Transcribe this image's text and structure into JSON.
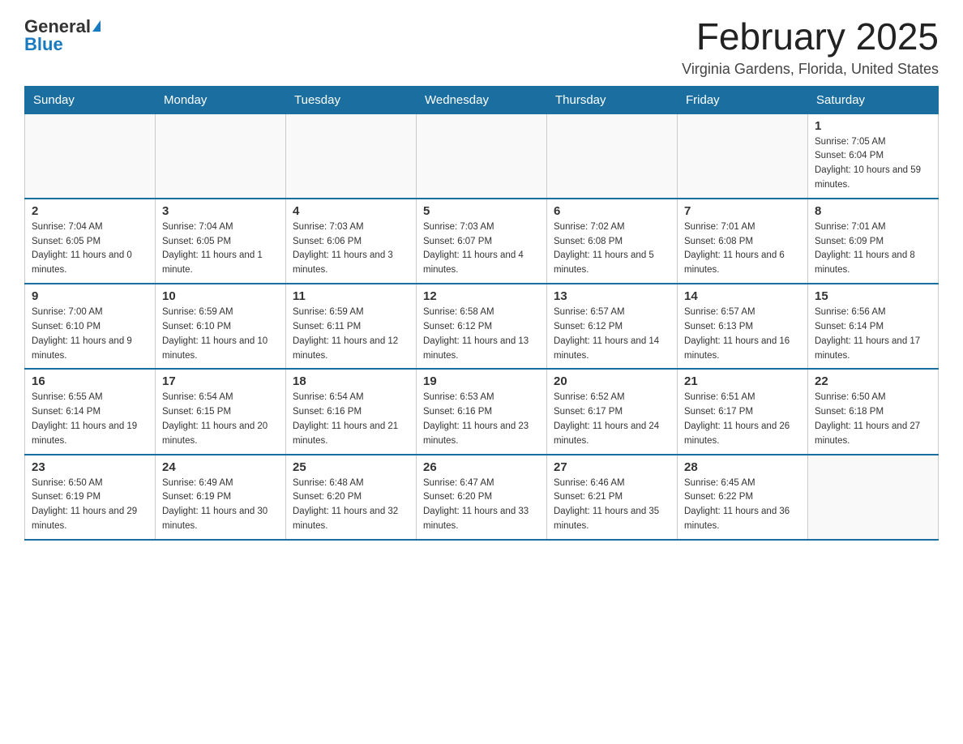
{
  "logo": {
    "general": "General",
    "blue": "Blue"
  },
  "title": "February 2025",
  "subtitle": "Virginia Gardens, Florida, United States",
  "days_of_week": [
    "Sunday",
    "Monday",
    "Tuesday",
    "Wednesday",
    "Thursday",
    "Friday",
    "Saturday"
  ],
  "weeks": [
    [
      {
        "day": "",
        "sunrise": "",
        "sunset": "",
        "daylight": ""
      },
      {
        "day": "",
        "sunrise": "",
        "sunset": "",
        "daylight": ""
      },
      {
        "day": "",
        "sunrise": "",
        "sunset": "",
        "daylight": ""
      },
      {
        "day": "",
        "sunrise": "",
        "sunset": "",
        "daylight": ""
      },
      {
        "day": "",
        "sunrise": "",
        "sunset": "",
        "daylight": ""
      },
      {
        "day": "",
        "sunrise": "",
        "sunset": "",
        "daylight": ""
      },
      {
        "day": "1",
        "sunrise": "Sunrise: 7:05 AM",
        "sunset": "Sunset: 6:04 PM",
        "daylight": "Daylight: 10 hours and 59 minutes."
      }
    ],
    [
      {
        "day": "2",
        "sunrise": "Sunrise: 7:04 AM",
        "sunset": "Sunset: 6:05 PM",
        "daylight": "Daylight: 11 hours and 0 minutes."
      },
      {
        "day": "3",
        "sunrise": "Sunrise: 7:04 AM",
        "sunset": "Sunset: 6:05 PM",
        "daylight": "Daylight: 11 hours and 1 minute."
      },
      {
        "day": "4",
        "sunrise": "Sunrise: 7:03 AM",
        "sunset": "Sunset: 6:06 PM",
        "daylight": "Daylight: 11 hours and 3 minutes."
      },
      {
        "day": "5",
        "sunrise": "Sunrise: 7:03 AM",
        "sunset": "Sunset: 6:07 PM",
        "daylight": "Daylight: 11 hours and 4 minutes."
      },
      {
        "day": "6",
        "sunrise": "Sunrise: 7:02 AM",
        "sunset": "Sunset: 6:08 PM",
        "daylight": "Daylight: 11 hours and 5 minutes."
      },
      {
        "day": "7",
        "sunrise": "Sunrise: 7:01 AM",
        "sunset": "Sunset: 6:08 PM",
        "daylight": "Daylight: 11 hours and 6 minutes."
      },
      {
        "day": "8",
        "sunrise": "Sunrise: 7:01 AM",
        "sunset": "Sunset: 6:09 PM",
        "daylight": "Daylight: 11 hours and 8 minutes."
      }
    ],
    [
      {
        "day": "9",
        "sunrise": "Sunrise: 7:00 AM",
        "sunset": "Sunset: 6:10 PM",
        "daylight": "Daylight: 11 hours and 9 minutes."
      },
      {
        "day": "10",
        "sunrise": "Sunrise: 6:59 AM",
        "sunset": "Sunset: 6:10 PM",
        "daylight": "Daylight: 11 hours and 10 minutes."
      },
      {
        "day": "11",
        "sunrise": "Sunrise: 6:59 AM",
        "sunset": "Sunset: 6:11 PM",
        "daylight": "Daylight: 11 hours and 12 minutes."
      },
      {
        "day": "12",
        "sunrise": "Sunrise: 6:58 AM",
        "sunset": "Sunset: 6:12 PM",
        "daylight": "Daylight: 11 hours and 13 minutes."
      },
      {
        "day": "13",
        "sunrise": "Sunrise: 6:57 AM",
        "sunset": "Sunset: 6:12 PM",
        "daylight": "Daylight: 11 hours and 14 minutes."
      },
      {
        "day": "14",
        "sunrise": "Sunrise: 6:57 AM",
        "sunset": "Sunset: 6:13 PM",
        "daylight": "Daylight: 11 hours and 16 minutes."
      },
      {
        "day": "15",
        "sunrise": "Sunrise: 6:56 AM",
        "sunset": "Sunset: 6:14 PM",
        "daylight": "Daylight: 11 hours and 17 minutes."
      }
    ],
    [
      {
        "day": "16",
        "sunrise": "Sunrise: 6:55 AM",
        "sunset": "Sunset: 6:14 PM",
        "daylight": "Daylight: 11 hours and 19 minutes."
      },
      {
        "day": "17",
        "sunrise": "Sunrise: 6:54 AM",
        "sunset": "Sunset: 6:15 PM",
        "daylight": "Daylight: 11 hours and 20 minutes."
      },
      {
        "day": "18",
        "sunrise": "Sunrise: 6:54 AM",
        "sunset": "Sunset: 6:16 PM",
        "daylight": "Daylight: 11 hours and 21 minutes."
      },
      {
        "day": "19",
        "sunrise": "Sunrise: 6:53 AM",
        "sunset": "Sunset: 6:16 PM",
        "daylight": "Daylight: 11 hours and 23 minutes."
      },
      {
        "day": "20",
        "sunrise": "Sunrise: 6:52 AM",
        "sunset": "Sunset: 6:17 PM",
        "daylight": "Daylight: 11 hours and 24 minutes."
      },
      {
        "day": "21",
        "sunrise": "Sunrise: 6:51 AM",
        "sunset": "Sunset: 6:17 PM",
        "daylight": "Daylight: 11 hours and 26 minutes."
      },
      {
        "day": "22",
        "sunrise": "Sunrise: 6:50 AM",
        "sunset": "Sunset: 6:18 PM",
        "daylight": "Daylight: 11 hours and 27 minutes."
      }
    ],
    [
      {
        "day": "23",
        "sunrise": "Sunrise: 6:50 AM",
        "sunset": "Sunset: 6:19 PM",
        "daylight": "Daylight: 11 hours and 29 minutes."
      },
      {
        "day": "24",
        "sunrise": "Sunrise: 6:49 AM",
        "sunset": "Sunset: 6:19 PM",
        "daylight": "Daylight: 11 hours and 30 minutes."
      },
      {
        "day": "25",
        "sunrise": "Sunrise: 6:48 AM",
        "sunset": "Sunset: 6:20 PM",
        "daylight": "Daylight: 11 hours and 32 minutes."
      },
      {
        "day": "26",
        "sunrise": "Sunrise: 6:47 AM",
        "sunset": "Sunset: 6:20 PM",
        "daylight": "Daylight: 11 hours and 33 minutes."
      },
      {
        "day": "27",
        "sunrise": "Sunrise: 6:46 AM",
        "sunset": "Sunset: 6:21 PM",
        "daylight": "Daylight: 11 hours and 35 minutes."
      },
      {
        "day": "28",
        "sunrise": "Sunrise: 6:45 AM",
        "sunset": "Sunset: 6:22 PM",
        "daylight": "Daylight: 11 hours and 36 minutes."
      },
      {
        "day": "",
        "sunrise": "",
        "sunset": "",
        "daylight": ""
      }
    ]
  ]
}
